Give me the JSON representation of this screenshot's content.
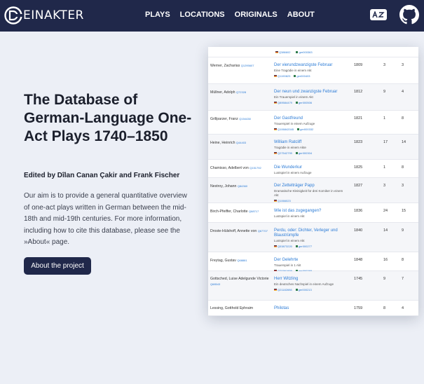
{
  "header": {
    "logo_text": "EINAKTER",
    "nav": [
      "PLAYS",
      "LOCATIONS",
      "ORIGINALS",
      "ABOUT"
    ],
    "lang_icon": "translate-icon",
    "github_icon": "github-icon"
  },
  "hero": {
    "title": "The Database of German-Language One-Act Plays 1740–1850",
    "editors": "Edited by Dîlan Canan Çakir and Frank Fischer",
    "description": "Our aim is to provide a general quantitative overview of one-act plays written in German between the mid-18th and mid-19th centuries. For more information, including how to cite this database, please see the »About« page.",
    "button": "About the project"
  },
  "table": {
    "top_ids": [
      "Q386602",
      "ger000363"
    ],
    "rows": [
      {
        "author": "Werner, Zacharias",
        "author_id": "Q1295607",
        "title": "Der vierundzwanzigste Februar",
        "subtitle": "Eine Tragödie in einem Akt",
        "ids": [
          "Q1190823",
          "ger000403"
        ],
        "year": "1809",
        "c1": "3",
        "c2": "3"
      },
      {
        "author": "Müllner, Adolph",
        "author_id": "Q72328",
        "title": "Der neun und zwanzigste Februar",
        "subtitle": "Ein Trauerspiel in einem Akt",
        "ids": [
          "Q89584479",
          "ger000506"
        ],
        "year": "1812",
        "c1": "9",
        "c2": "4"
      },
      {
        "author": "Grillparzer, Franz",
        "author_id": "Q154438",
        "title": "Der Gastfreund",
        "subtitle": "Trauerspiel in einem Aufzuge",
        "ids": [
          "Q106842045",
          "ger000332"
        ],
        "year": "1821",
        "c1": "1",
        "c2": "8"
      },
      {
        "author": "Heine, Heinrich",
        "author_id": "Q44403",
        "title": "William Ratcliff",
        "subtitle": "Tragödie in einem Akte",
        "ids": [
          "Q27542799",
          "ger000304"
        ],
        "year": "1823",
        "c1": "17",
        "c2": "14"
      },
      {
        "author": "Chamisso, Adelbert von",
        "author_id": "Q151792",
        "title": "Die Wunderkur",
        "subtitle": "Lustspiel in einem Aufzuge",
        "ids": [],
        "year": "1825",
        "c1": "1",
        "c2": "8"
      },
      {
        "author": "Nestroy, Johann",
        "author_id": "Q84360",
        "title": "Der Zettelträger Papp",
        "subtitle": "Dramatische Kleinigkeit für drei Komiker in einem Akt",
        "ids": [
          "Q1066023"
        ],
        "year": "1827",
        "c1": "3",
        "c2": "3"
      },
      {
        "author": "Birch-Pfeiffer, Charlotte",
        "author_id": "Q68717",
        "title": "Wie ist das zugegangen?",
        "subtitle": "Lustspiel in einem Akt",
        "ids": [],
        "year": "1836",
        "c1": "24",
        "c2": "15"
      },
      {
        "author": "Droste-Hülshoff, Annette von",
        "author_id": "Q67707",
        "title": "Perdu, oder: Dichter, Verleger und Blaustrümpfe",
        "subtitle": "Lustspiel in einem Akt",
        "ids": [
          "Q53873220",
          "ger000277"
        ],
        "year": "1840",
        "c1": "14",
        "c2": "9"
      },
      {
        "author": "Freytag, Gustav",
        "author_id": "Q68881",
        "title": "Der Gelehrte",
        "subtitle": "Trauerspiel in 1 Akt",
        "ids": [
          "Q70361909",
          "ger000265"
        ],
        "year": "1848",
        "c1": "16",
        "c2": "8"
      },
      {
        "author": "Gottsched, Luise Adelgunde Victorie",
        "author_id": "Q68543",
        "title": "Herr Witzling",
        "subtitle": "Ein deutsches Nachspiel in einem Aufzuge",
        "ids": [
          "Q21182698",
          "ger000213"
        ],
        "year": "1745",
        "c1": "9",
        "c2": "7"
      },
      {
        "author": "Lessing, Gotthold Ephraim",
        "author_id": "",
        "title": "Philotas",
        "subtitle": "",
        "ids": [],
        "year": "1759",
        "c1": "8",
        "c2": "4"
      }
    ]
  }
}
